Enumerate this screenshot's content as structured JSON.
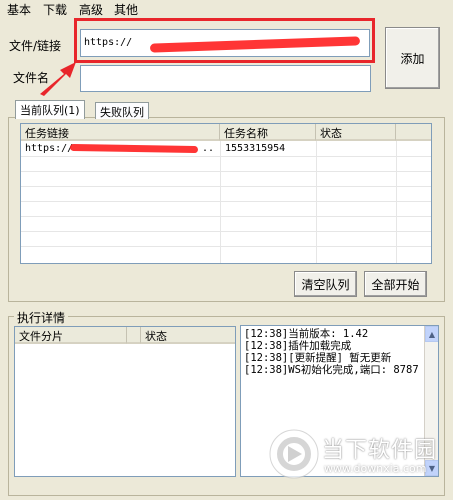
{
  "menu": [
    "基本",
    "下载",
    "高级",
    "其他"
  ],
  "form": {
    "url_label": "文件/链接",
    "url_value": "https://",
    "filename_label": "文件名",
    "filename_value": "",
    "add_button": "添加"
  },
  "tabs": [
    "当前队列(1)",
    "失败队列"
  ],
  "queue": {
    "columns": [
      "任务链接",
      "任务名称",
      "状态"
    ],
    "rows": [
      {
        "link": "https://",
        "link_tail": "..",
        "name": "1553315954",
        "status": ""
      }
    ]
  },
  "buttons": {
    "clear_queue": "清空队列",
    "start_all": "全部开始"
  },
  "details": {
    "title": "执行详情",
    "columns": [
      "文件分片",
      "状态"
    ]
  },
  "log": [
    "[12:38]当前版本: 1.42",
    "[12:38]插件加载完成",
    "[12:38][更新提醒] 暂无更新",
    "[12:38]WS初始化完成,端口: 8787"
  ],
  "watermark": {
    "brand": "当下软件园",
    "url": "www.downxia.com"
  },
  "colors": {
    "annotation_red": "#e8262b",
    "window_bg": "#ece9d8"
  }
}
